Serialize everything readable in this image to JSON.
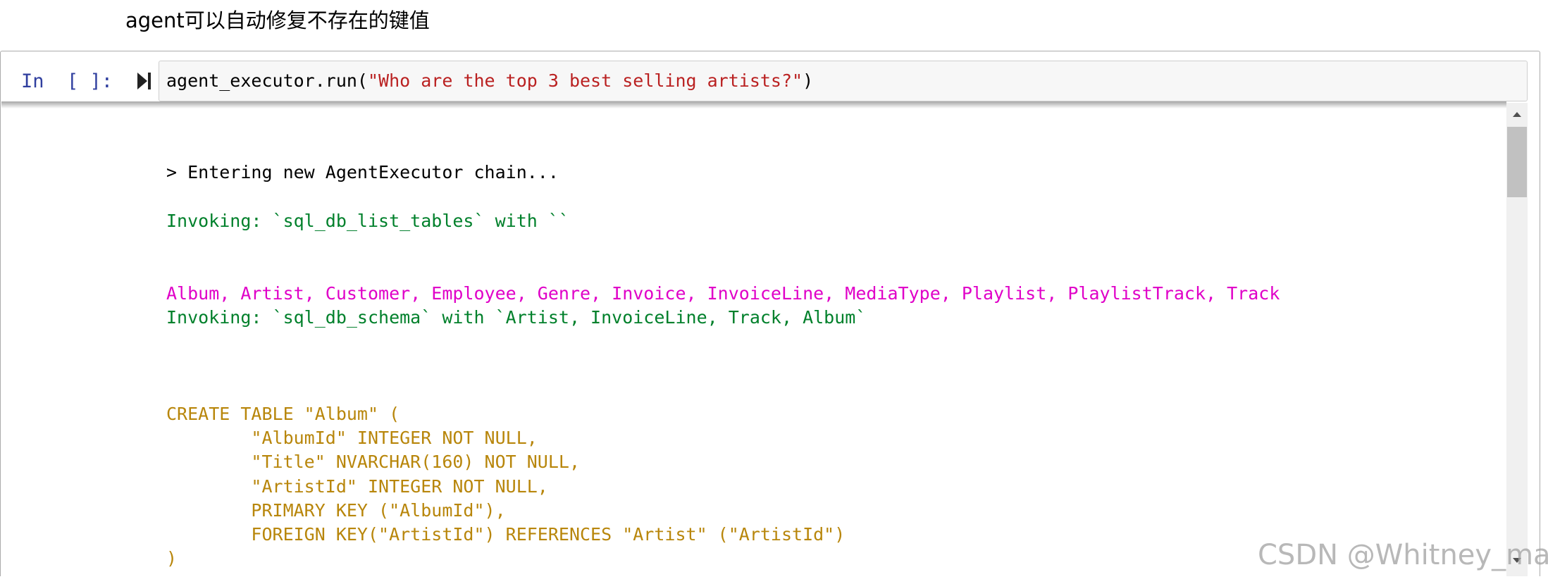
{
  "markdown": {
    "text": "agent可以自动修复不存在的键值"
  },
  "cell": {
    "prompt": "In  [ ]:",
    "code_prefix": "agent_executor.run(",
    "code_string": "\"Who are the top 3 best selling artists?\"",
    "code_suffix": ")"
  },
  "output": {
    "lines": [
      {
        "text": "> Entering new AgentExecutor chain...",
        "color": "black"
      },
      {
        "text": "Invoking: `sql_db_list_tables` with ``",
        "color": "green"
      },
      {
        "text": "Album, Artist, Customer, Employee, Genre, Invoice, InvoiceLine, MediaType, Playlist, PlaylistTrack, Track",
        "color": "magenta"
      },
      {
        "text": "Invoking: `sql_db_schema` with `Artist, InvoiceLine, Track, Album`",
        "color": "green"
      },
      {
        "text": "CREATE TABLE \"Album\" (",
        "color": "gold"
      },
      {
        "text": "        \"AlbumId\" INTEGER NOT NULL,",
        "color": "gold"
      },
      {
        "text": "        \"Title\" NVARCHAR(160) NOT NULL,",
        "color": "gold"
      },
      {
        "text": "        \"ArtistId\" INTEGER NOT NULL,",
        "color": "gold"
      },
      {
        "text": "        PRIMARY KEY (\"AlbumId\"),",
        "color": "gold"
      },
      {
        "text": "        FOREIGN KEY(\"ArtistId\") REFERENCES \"Artist\" (\"ArtistId\")",
        "color": "gold"
      },
      {
        "text": ")",
        "color": "gold"
      }
    ]
  },
  "colors": {
    "black": "#000000",
    "green": "#00802b",
    "magenta": "#e000c8",
    "gold": "#b8860b",
    "prompt": "#303f9f",
    "string": "#ba2121"
  },
  "icons": {
    "run": "run-cell-icon",
    "scroll_up": "scroll-up-arrow-icon",
    "scroll_down": "scroll-down-arrow-icon"
  },
  "watermark": "CSDN @Whitney_mao"
}
